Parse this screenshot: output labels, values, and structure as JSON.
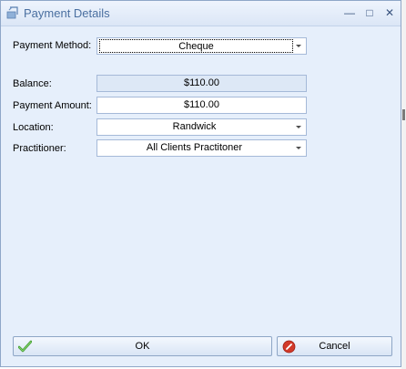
{
  "window": {
    "title": "Payment Details",
    "minimize_glyph": "—",
    "maximize_glyph": "□",
    "close_glyph": "✕"
  },
  "form": {
    "payment_method": {
      "label": "Payment Method:",
      "value": "Cheque"
    },
    "balance": {
      "label": "Balance:",
      "value": "$110.00"
    },
    "payment_amount": {
      "label": "Payment Amount:",
      "value": "$110.00"
    },
    "location": {
      "label": "Location:",
      "value": "Randwick"
    },
    "practitioner": {
      "label": "Practitioner:",
      "value": "All Clients Practitoner"
    }
  },
  "buttons": {
    "ok": "OK",
    "cancel": "Cancel"
  },
  "icons": {
    "app": "payment-app-icon",
    "ok": "green-check-icon",
    "cancel": "red-cancel-icon",
    "dropdown": "chevron-down-icon"
  },
  "colors": {
    "window_bg": "#e6effb",
    "title_text": "#4a6fa0",
    "readonly_bg": "#dde8f6"
  }
}
